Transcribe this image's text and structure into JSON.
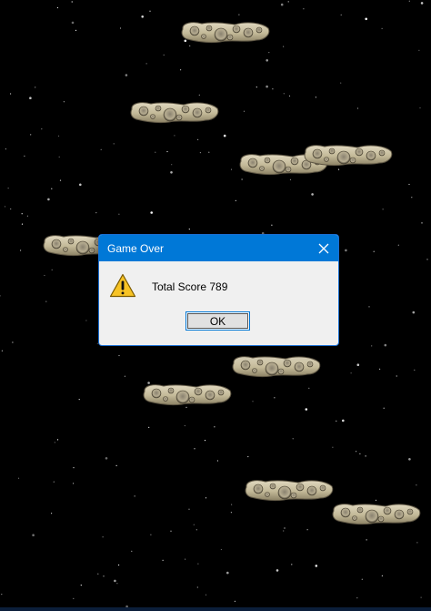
{
  "window": {
    "title": "Game Over",
    "close_icon": "close-icon"
  },
  "dialog": {
    "icon": "warning-icon",
    "message": "Total Score 789",
    "ok_label": "OK"
  },
  "colors": {
    "background": "#000000",
    "titlebar": "#0078d7",
    "dialog_bg": "#f0f0f0",
    "asteroid": "#c9c0a4"
  }
}
